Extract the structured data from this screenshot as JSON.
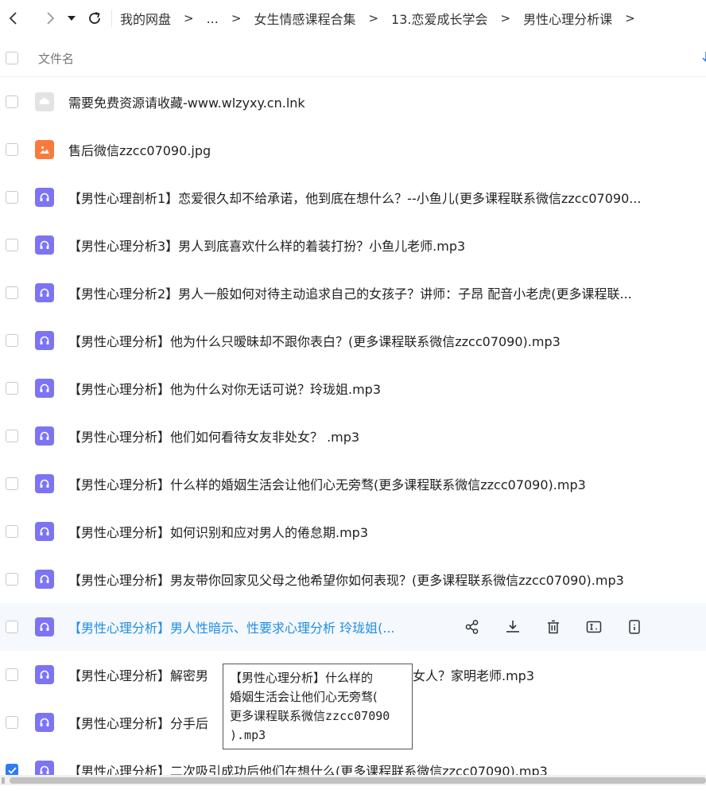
{
  "nav": {
    "back_icon": "chevron-left-icon",
    "forward_icon": "chevron-right-icon",
    "dropdown_icon": "caret-down-icon",
    "refresh_icon": "refresh-icon",
    "breadcrumbs": [
      "我的网盘",
      "...",
      "女生情感课程合集",
      "13.恋爱成长学会",
      "男性心理分析课"
    ],
    "separator": ">"
  },
  "header": {
    "column_name": "文件名",
    "sort_icon": "sort-arrow-icon"
  },
  "files": [
    {
      "name": "需要免费资源请收藏-www.wlzyxy.cn.lnk",
      "type": "link",
      "checked": false
    },
    {
      "name": "售后微信zzcc07090.jpg",
      "type": "image",
      "checked": false
    },
    {
      "name": "【男性心理剖析1】恋爱很久却不给承诺，他到底在想什么？--小鱼儿(更多课程联系微信zzcc07090...",
      "type": "audio",
      "checked": false
    },
    {
      "name": "【男性心理分析3】男人到底喜欢什么样的着装打扮？小鱼儿老师.mp3",
      "type": "audio",
      "checked": false
    },
    {
      "name": "【男性心理分析2】男人一般如何对待主动追求自己的女孩子？讲师：子昂  配音小老虎(更多课程联...",
      "type": "audio",
      "checked": false
    },
    {
      "name": "【男性心理分析】他为什么只暧昧却不跟你表白？(更多课程联系微信zzcc07090).mp3",
      "type": "audio",
      "checked": false
    },
    {
      "name": "【男性心理分析】他为什么对你无话可说？玲珑姐.mp3",
      "type": "audio",
      "checked": false
    },
    {
      "name": "【男性心理分析】他们如何看待女友非处女？ .mp3",
      "type": "audio",
      "checked": false
    },
    {
      "name": "【男性心理分析】什么样的婚姻生活会让他们心无旁骛(更多课程联系微信zzcc07090).mp3",
      "type": "audio",
      "checked": false
    },
    {
      "name": "【男性心理分析】如何识别和应对男人的倦怠期.mp3",
      "type": "audio",
      "checked": false
    },
    {
      "name": "【男性心理分析】男友带你回家见父母之他希望你如何表现？(更多课程联系微信zzcc07090).mp3",
      "type": "audio",
      "checked": false
    },
    {
      "name": "【男性心理分析】男人性暗示、性要求心理分析 玲珑姐(...",
      "type": "audio",
      "checked": false,
      "hover": true
    },
    {
      "name": "【男性心理分析】解密男",
      "name_tail": "女人？家明老师.mp3",
      "type": "audio",
      "checked": false
    },
    {
      "name": "【男性心理分析】分手后",
      "type": "audio",
      "checked": false
    },
    {
      "name": "【男性心理分析】二次吸引成功后他们在想什么(更多课程联系微信zzcc07090).mp3",
      "type": "audio",
      "checked": true
    }
  ],
  "hover_actions": [
    {
      "icon": "share-icon"
    },
    {
      "icon": "download-icon"
    },
    {
      "icon": "delete-icon"
    },
    {
      "icon": "rename-icon"
    },
    {
      "icon": "info-icon"
    }
  ],
  "tooltip": {
    "line1": "【男性心理分析】什么样的",
    "line2": "婚姻生活会让他们心无旁骛(",
    "line3_cn": "更多课程联系微信",
    "line3_code": "zzcc07090",
    "line4": ").mp3"
  },
  "colors": {
    "accent": "#1f8ee8",
    "audio_icon": "#7d74f3",
    "image_icon": "#fa7a3c",
    "checkbox_checked": "#2f7bf6"
  }
}
